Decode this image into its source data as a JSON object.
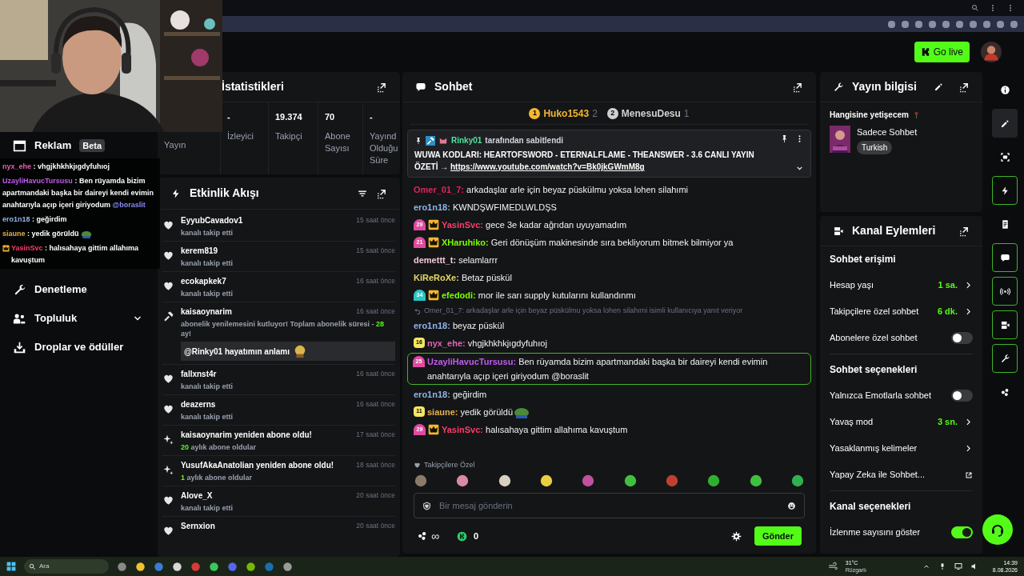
{
  "header": {
    "go_live": "Go live"
  },
  "sidebar": {
    "items": [
      {
        "label": "Reklam",
        "badge": "Beta",
        "kind": "ad",
        "submenu": false
      },
      {
        "label": "Denetleme",
        "kind": "wrench",
        "submenu": false
      },
      {
        "label": "Topluluk",
        "kind": "people",
        "submenu": true
      },
      {
        "label": "Droplar ve ödüller",
        "kind": "drops",
        "submenu": false
      }
    ]
  },
  "overlay_chat": {
    "messages": [
      {
        "user": "nyx_ehe",
        "color": "#e064b4",
        "badge": false,
        "text": ": vhgjkhkhkjıgdyfuhıoj",
        "emote": false
      },
      {
        "user": "UzayliHavucTursusu",
        "color": "#c25cf0",
        "badge": false,
        "text": ": Ben rüyamda bizim apartmandaki başka bir daireyi kendi evimin anahtarıyla açıp içeri giriyodum",
        "mention": "@boraslit",
        "emote": false
      },
      {
        "user": "ero1n18",
        "color": "#8fb4e8",
        "badge": false,
        "text": ": geğirdim",
        "emote": false
      },
      {
        "user": "siaune",
        "color": "#e8b04a",
        "badge": false,
        "text": ": yedik görüldü",
        "emote": true
      },
      {
        "user": "YasinSvc",
        "color": "#ff3b6b",
        "badge": true,
        "text": ": halısahaya gittim allahıma kavuştum",
        "emote": false
      }
    ]
  },
  "stats": {
    "title": "İstatistikleri",
    "items": [
      {
        "label": "Yayın"
      },
      {
        "value": "-",
        "label": "İzleyici"
      },
      {
        "value": "19.374",
        "label": "Takipçi"
      },
      {
        "value": "70",
        "label": "Abone Sayısı"
      },
      {
        "value": "-",
        "label": "Yayınd Olduğu Süre"
      }
    ]
  },
  "activity": {
    "title": "Etkinlik Akışı",
    "events": [
      {
        "kind": "follow",
        "title": "EyyubCavadov1",
        "time": "15 saat önce",
        "subtitle": [
          {
            "text": "kanalı takip etti"
          }
        ]
      },
      {
        "kind": "follow",
        "title": "kerem819",
        "time": "15 saat önce",
        "subtitle": [
          {
            "text": "kanalı takip etti"
          }
        ]
      },
      {
        "kind": "follow",
        "title": "ecokapkek7",
        "time": "16 saat önce",
        "subtitle": [
          {
            "text": "kanalı takip etti"
          }
        ]
      },
      {
        "kind": "renewal",
        "title": "kaisaoynarim",
        "time": "16 saat önce",
        "subtitle": [
          {
            "text": "abonelik yenilemesini kutluyor! Toplam abonelik süresi - "
          },
          {
            "text": "28",
            "highlight": true
          },
          {
            "text": " ay!"
          }
        ],
        "quote": "@Rinky01 hayatımın anlamı"
      },
      {
        "kind": "follow",
        "title": "fallxnst4r",
        "time": "16 saat önce",
        "subtitle": [
          {
            "text": "kanalı takip etti"
          }
        ]
      },
      {
        "kind": "follow",
        "title": "deazerns",
        "time": "16 saat önce",
        "subtitle": [
          {
            "text": "kanalı takip etti"
          }
        ]
      },
      {
        "kind": "resub",
        "title": "kaisaoynarim yeniden abone oldu!",
        "time": "17 saat önce",
        "subtitle": [
          {
            "text": "20",
            "highlight": true
          },
          {
            "text": " aylık abone oldular"
          }
        ]
      },
      {
        "kind": "resub",
        "title": "YusufAkaAnatolian yeniden abone oldu!",
        "time": "18 saat önce",
        "subtitle": [
          {
            "text": "1",
            "highlight": true
          },
          {
            "text": " aylık abone oldular"
          }
        ]
      },
      {
        "kind": "follow",
        "title": "Alove_X",
        "time": "20 saat önce",
        "subtitle": [
          {
            "text": "kanalı takip etti"
          }
        ]
      },
      {
        "kind": "follow",
        "title": "Sernxion",
        "time": "20 saat önce"
      }
    ]
  },
  "chat": {
    "title": "Sohbet",
    "top_chatters": [
      {
        "rank": "1",
        "name": "Huko1543",
        "count": "2",
        "color": "#f5b82e"
      },
      {
        "rank": "2",
        "name": "MenesuDesu",
        "count": "1",
        "color": "#d0d0d0"
      }
    ],
    "pinned": {
      "by": "Rinky01",
      "note": "tarafından sabitlendi",
      "text": "WUWA KODLARI: HEARTOFSWORD - ETERNALFLAME - THEANSWER - 3.6 CANLI YAYIN ÖZETİ → ",
      "link": "https://www.youtube.com/watch?v=Bk0jkGWmM8g"
    },
    "messages": [
      {
        "user": "Omer_01_7:",
        "color": "#e0245e",
        "text": "arkadaşlar arle için beyaz püskülmu yoksa lohen silahımi",
        "highlighted": false
      },
      {
        "user": "ero1n18:",
        "color": "#8fb4e8",
        "text": "KWNDŞWFIMEDLWLDŞS",
        "highlighted": false
      },
      {
        "badges": [
          {
            "kind": "level",
            "text": "29",
            "color": "#e04ba0"
          },
          {
            "kind": "crown",
            "color": "#f5b82e"
          }
        ],
        "user": "YasinSvc:",
        "color": "#ff3b6b",
        "text": "gece 3e kadar ağrıdan uyuyamadım",
        "highlighted": false
      },
      {
        "badges": [
          {
            "kind": "level",
            "text": "21",
            "color": "#e04ba0"
          },
          {
            "kind": "crown",
            "color": "#f5b82e"
          }
        ],
        "user": "XHaruhiko:",
        "color": "#7cfc00",
        "text": "Geri dönüşüm makinesinde sıra bekliyorum bitmek bilmiyor ya",
        "highlighted": false
      },
      {
        "user": "demettt_t:",
        "color": "#f2c9d4",
        "text": "selamlarrr",
        "highlighted": false
      },
      {
        "user": "KiReRoXe:",
        "color": "#e8d86a",
        "text": "Betaz püskül",
        "highlighted": false
      },
      {
        "badges": [
          {
            "kind": "level",
            "text": "34",
            "color": "#2ec4c4"
          },
          {
            "kind": "crown",
            "color": "#f5b82e"
          }
        ],
        "user": "efedodi:",
        "color": "#7cfc00",
        "text": "mor ile sarı supply kutularını kullandınmı",
        "highlighted": false
      },
      {
        "reply_to": "Omer_01_7: arkadaşlar arle için beyaz püskülmu yoksa lohen silahımi isimli kullanıcıya yanıt veriyor",
        "user": "ero1n18:",
        "color": "#8fb4e8",
        "text": "beyaz püskül",
        "highlighted": false
      },
      {
        "badges": [
          {
            "kind": "square",
            "text": "16",
            "color": "#f5e663"
          }
        ],
        "user": "nyx_ehe:",
        "color": "#e064b4",
        "text": "vhgjkhkhkjıgdyfuhıoj",
        "highlighted": false
      },
      {
        "badges": [
          {
            "kind": "level",
            "text": "25",
            "color": "#e04ba0"
          }
        ],
        "user": "UzayliHavucTursusu:",
        "color": "#c25cf0",
        "text": "Ben rüyamda bizim apartmandaki başka bir daireyi kendi evimin anahtarıyla açıp içeri giriyodum @boraslit",
        "highlighted": true
      },
      {
        "user": "ero1n18:",
        "color": "#8fb4e8",
        "text": "geğirdim",
        "highlighted": false
      },
      {
        "badges": [
          {
            "kind": "square",
            "text": "11",
            "color": "#f5e663"
          }
        ],
        "user": "siaune:",
        "color": "#e8b04a",
        "text": "yedik görüldü",
        "emote": true,
        "highlighted": false
      },
      {
        "badges": [
          {
            "kind": "level",
            "text": "29",
            "color": "#e04ba0"
          },
          {
            "kind": "crown",
            "color": "#f5b82e"
          }
        ],
        "user": "YasinSvc:",
        "color": "#ff3b6b",
        "text": "halısahaya gittim allahıma kavuştum",
        "highlighted": false
      }
    ],
    "emote_section": "Takipçilere Özel",
    "input": {
      "placeholder": "Bir mesaj gönderin"
    },
    "points": "∞",
    "kicks": "0",
    "send": "Gönder"
  },
  "stream_info": {
    "title": "Yayın bilgisi",
    "stream_title": "Hangisine yetişecem",
    "category": "Sadece Sohbet",
    "tag": "Turkish"
  },
  "channel_actions": {
    "title": "Kanal Eylemleri",
    "sections": [
      {
        "title": "Sohbet erişimi",
        "rows": [
          {
            "kind": "value",
            "label": "Hesap yaşı",
            "value": "1 sa."
          },
          {
            "kind": "value",
            "label": "Takipçilere özel sohbet",
            "value": "6 dk."
          },
          {
            "kind": "toggle",
            "label": "Abonelere özel sohbet",
            "on": false
          }
        ]
      },
      {
        "title": "Sohbet seçenekleri",
        "rows": [
          {
            "kind": "toggle",
            "label": "Yalnızca Emotlarla sohbet",
            "on": false
          },
          {
            "kind": "value",
            "label": "Yavaş mod",
            "value": "3 sn."
          },
          {
            "kind": "link",
            "label": "Yasaklanmış kelimeler"
          },
          {
            "kind": "external",
            "label": "Yapay Zeka ile Sohbet..."
          }
        ]
      },
      {
        "title": "Kanal seçenekleri",
        "rows": [
          {
            "kind": "toggle",
            "label": "İzlenme sayısını göster",
            "on": true
          }
        ]
      }
    ]
  },
  "rail": [
    {
      "kind": "info",
      "active": false,
      "selected": false
    },
    {
      "kind": "pencil",
      "active": false,
      "selected": true
    },
    {
      "kind": "capture",
      "active": false,
      "selected": false
    },
    {
      "kind": "bolt",
      "active": true,
      "selected": false
    },
    {
      "kind": "note",
      "active": false,
      "selected": false
    },
    {
      "kind": "chat",
      "active": true,
      "selected": false
    },
    {
      "kind": "broadcast",
      "active": true,
      "selected": false
    },
    {
      "kind": "camera",
      "active": true,
      "selected": false
    },
    {
      "kind": "wrench",
      "active": true,
      "selected": false
    },
    {
      "kind": "dots",
      "active": false,
      "selected": false
    }
  ],
  "taskbar": {
    "search": "Ara",
    "temperature": "31°C",
    "weather": "Rüzgarlı",
    "time": "14:39",
    "date": "8.08.2026"
  }
}
